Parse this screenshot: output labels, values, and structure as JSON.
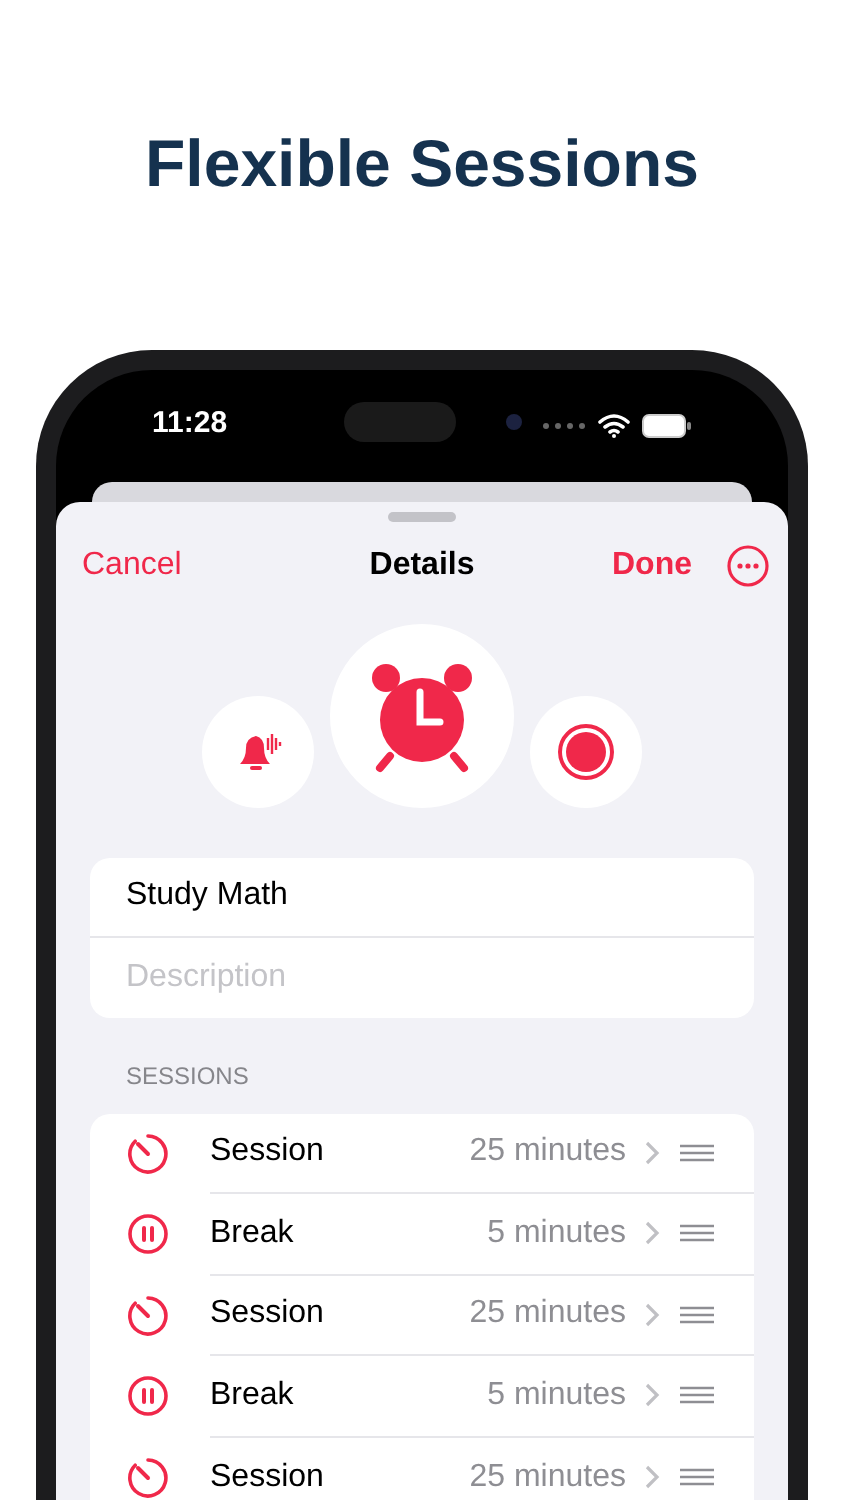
{
  "headline": "Flexible Sessions",
  "status_bar": {
    "time": "11:28"
  },
  "nav": {
    "cancel": "Cancel",
    "title": "Details",
    "done": "Done"
  },
  "sound_choices": [
    {
      "kind": "bell",
      "selected": false
    },
    {
      "kind": "alarm",
      "selected": true
    },
    {
      "kind": "record",
      "selected": false
    }
  ],
  "form": {
    "name": "Study Math",
    "description_placeholder": "Description"
  },
  "sessions": {
    "header": "SESSIONS",
    "rows": [
      {
        "kind": "session",
        "label": "Session",
        "duration": "25 minutes"
      },
      {
        "kind": "break",
        "label": "Break",
        "duration": "5 minutes"
      },
      {
        "kind": "session",
        "label": "Session",
        "duration": "25 minutes"
      },
      {
        "kind": "break",
        "label": "Break",
        "duration": "5 minutes"
      },
      {
        "kind": "session",
        "label": "Session",
        "duration": "25 minutes"
      }
    ]
  }
}
